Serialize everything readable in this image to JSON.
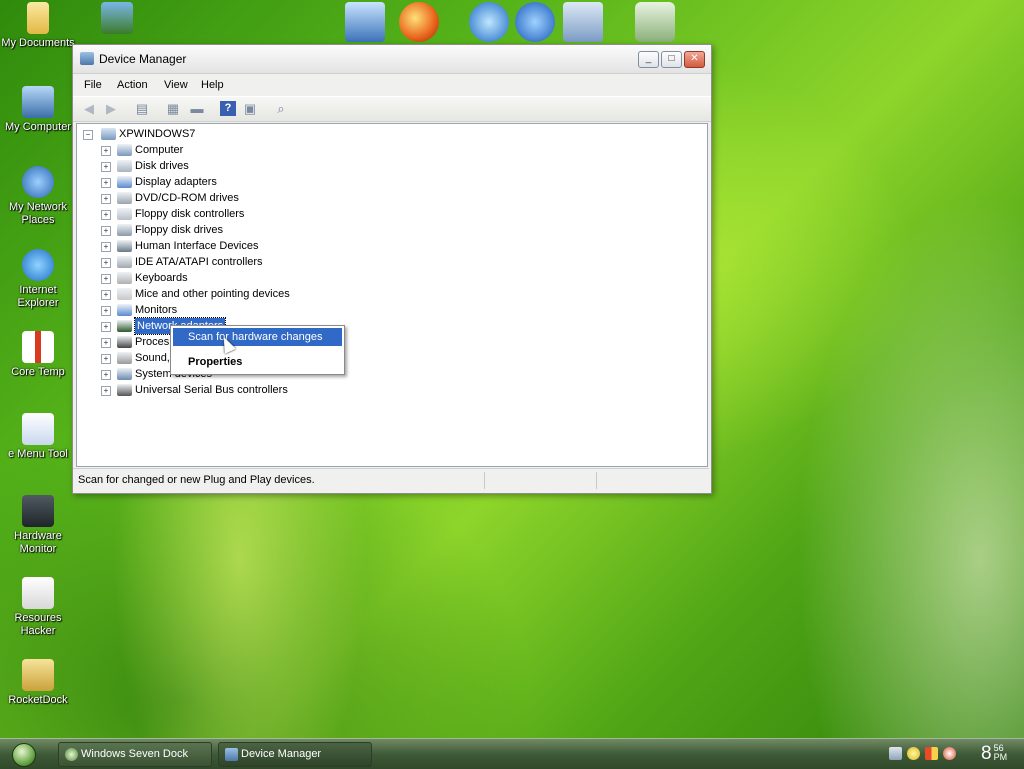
{
  "desktop": {
    "icons": [
      {
        "label": "My Documents",
        "icon": "folder-icon"
      },
      {
        "label": "My Computer",
        "icon": "computer-icon"
      },
      {
        "label": "My Network Places",
        "icon": "network-icon"
      },
      {
        "label": "Internet Explorer",
        "icon": "ie-icon"
      },
      {
        "label": "Core Temp",
        "icon": "thermometer-icon"
      },
      {
        "label": "e Menu Tool",
        "icon": "document-icon"
      },
      {
        "label": "Hardware Monitor",
        "icon": "hardware-monitor-icon"
      },
      {
        "label": "Resoures Hacker",
        "icon": "hammer-icon"
      },
      {
        "label": "RocketDock",
        "icon": "rocketdock-icon"
      }
    ]
  },
  "dock": {
    "items": [
      "monitor-icon",
      "firefox-icon",
      "ie-icon",
      "media-player-icon",
      "tools-icon",
      "recycle-bin-icon"
    ]
  },
  "window": {
    "title": "Device Manager",
    "buttons": {
      "minimize": "_",
      "maximize": "□",
      "close": "✕"
    },
    "menu": [
      "File",
      "Action",
      "View",
      "Help"
    ],
    "toolbar": [
      "back-arrow-icon",
      "forward-arrow-icon",
      "show-hide-tree-icon",
      "properties-icon",
      "print-icon",
      "help-icon",
      "properties-sheet-icon",
      "scan-hardware-icon"
    ],
    "tree": {
      "root": "XPWINDOWS7",
      "nodes": [
        {
          "label": "Computer",
          "icon": "computer-icon"
        },
        {
          "label": "Disk drives",
          "icon": "disk-drive-icon"
        },
        {
          "label": "Display adapters",
          "icon": "display-adapter-icon"
        },
        {
          "label": "DVD/CD-ROM drives",
          "icon": "dvd-drive-icon"
        },
        {
          "label": "Floppy disk controllers",
          "icon": "floppy-controller-icon"
        },
        {
          "label": "Floppy disk drives",
          "icon": "floppy-drive-icon"
        },
        {
          "label": "Human Interface Devices",
          "icon": "hid-icon"
        },
        {
          "label": "IDE ATA/ATAPI controllers",
          "icon": "ide-controller-icon"
        },
        {
          "label": "Keyboards",
          "icon": "keyboard-icon"
        },
        {
          "label": "Mice and other pointing devices",
          "icon": "mouse-icon"
        },
        {
          "label": "Monitors",
          "icon": "monitor-icon"
        },
        {
          "label": "Network adapters",
          "icon": "network-adapter-icon",
          "selected": true
        },
        {
          "label": "Proces",
          "icon": "processor-icon"
        },
        {
          "label": "Sound,",
          "icon": "sound-icon"
        },
        {
          "label": "System devices",
          "icon": "system-device-icon"
        },
        {
          "label": "Universal Serial Bus controllers",
          "icon": "usb-icon"
        }
      ]
    },
    "status": "Scan for changed or new Plug and Play devices."
  },
  "context_menu": {
    "items": [
      {
        "label": "Scan for hardware changes",
        "highlighted": true
      },
      {
        "label": "Properties",
        "bold": true
      }
    ]
  },
  "taskbar": {
    "tasks": [
      {
        "label": "Windows Seven Dock"
      },
      {
        "label": "Device Manager"
      }
    ],
    "tray": [
      "network-icon",
      "smiley-icon",
      "security-icon",
      "shield-icon"
    ],
    "clock": {
      "hour": "8",
      "minutes": "56",
      "ampm": "PM"
    }
  }
}
